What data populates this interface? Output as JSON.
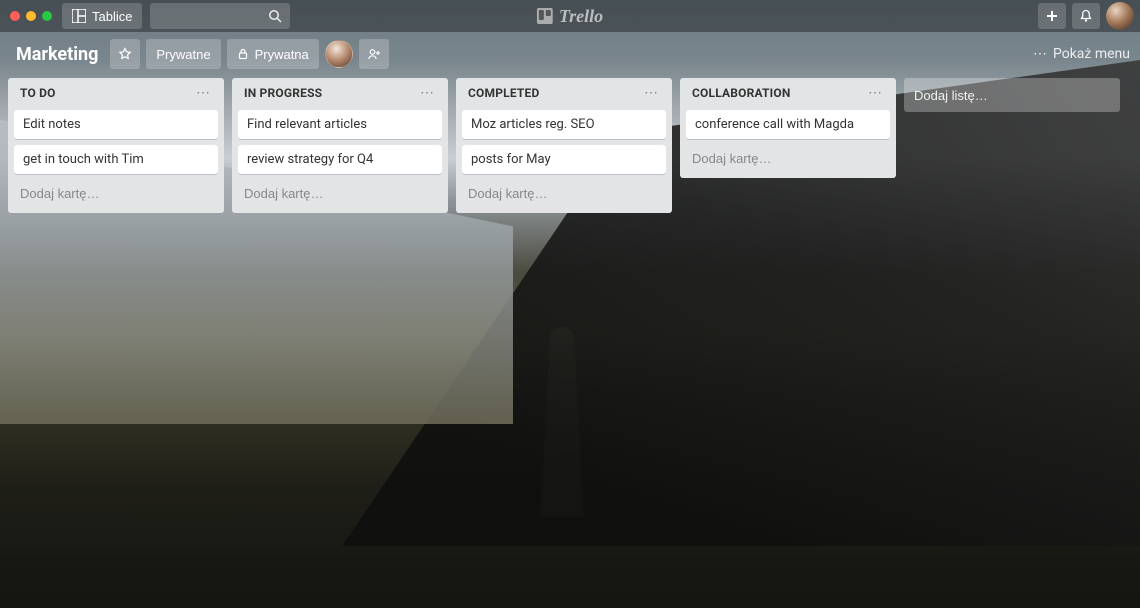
{
  "app": {
    "brand": "Trello",
    "boards_button": "Tablice"
  },
  "board": {
    "name": "Marketing",
    "visibility_private": "Prywatne",
    "team_private": "Prywatna",
    "show_menu": "Pokaż menu"
  },
  "lists": [
    {
      "title": "TO DO",
      "cards": [
        "Edit notes",
        "get in touch with Tim"
      ],
      "add_card": "Dodaj kartę…"
    },
    {
      "title": "IN PROGRESS",
      "cards": [
        "Find relevant articles",
        "review strategy for Q4"
      ],
      "add_card": "Dodaj kartę…"
    },
    {
      "title": "COMPLETED",
      "cards": [
        "Moz articles reg. SEO",
        "posts for May"
      ],
      "add_card": "Dodaj kartę…"
    },
    {
      "title": "COLLABORATION",
      "cards": [
        "conference call with Magda"
      ],
      "add_card": "Dodaj kartę…"
    }
  ],
  "add_list": "Dodaj listę…"
}
